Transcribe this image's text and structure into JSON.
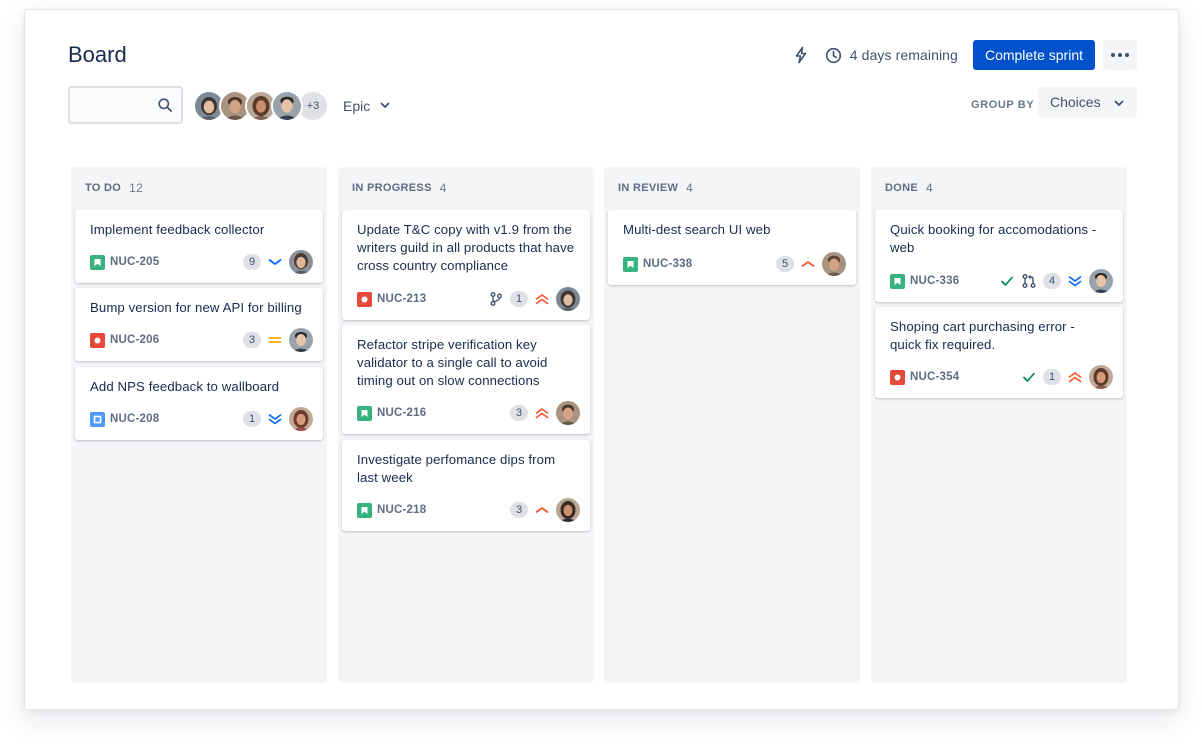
{
  "header": {
    "title": "Board",
    "remaining": "4 days remaining",
    "complete_sprint": "Complete sprint"
  },
  "toolbar": {
    "search_value": "",
    "more_people": "+3",
    "epic_label": "Epic",
    "group_by_label": "GROUP BY",
    "group_by_value": "Choices"
  },
  "colors": {
    "primary": "#0052cc",
    "story": "#36b37e",
    "bug": "#e5493a",
    "task": "#4c9aff",
    "high": "#ff5630",
    "low": "#0065ff",
    "medium": "#ffab00",
    "done_check": "#00875a"
  },
  "columns": [
    {
      "title": "TO DO",
      "count": "12",
      "cards": [
        {
          "title": "Implement feedback collector",
          "key": "NUC-205",
          "type": "story-icon",
          "badge": "9",
          "priority": "low-icon"
        },
        {
          "title": "Bump version for new API for billing",
          "key": "NUC-206",
          "type": "bug-icon",
          "badge": "3",
          "priority": "medium-icon"
        },
        {
          "title": "Add NPS feedback to wallboard",
          "key": "NUC-208",
          "type": "task-icon",
          "badge": "1",
          "priority": "lowest-icon"
        }
      ]
    },
    {
      "title": "IN PROGRESS",
      "count": "4",
      "cards": [
        {
          "title": "Update T&C copy with v1.9 from the writers guild in all products that have cross country compliance",
          "key": "NUC-213",
          "type": "bug-icon",
          "badge": "1",
          "priority": "highest-icon",
          "extra": "branch-icon"
        },
        {
          "title": "Refactor stripe verification key validator to a single call to avoid timing out on slow connections",
          "key": "NUC-216",
          "type": "story-icon",
          "badge": "3",
          "priority": "highest-icon"
        },
        {
          "title": "Investigate perfomance dips from last week",
          "key": "NUC-218",
          "type": "story-icon",
          "badge": "3",
          "priority": "high-icon"
        }
      ]
    },
    {
      "title": "IN REVIEW",
      "count": "4",
      "cards": [
        {
          "title": "Multi-dest search UI web",
          "key": "NUC-338",
          "type": "story-icon",
          "badge": "5",
          "priority": "high-icon"
        }
      ]
    },
    {
      "title": "DONE",
      "count": "4",
      "cards": [
        {
          "title": "Quick booking for accomodations - web",
          "key": "NUC-336",
          "type": "story-icon",
          "badge": "4",
          "priority": "lowest-icon",
          "extra": "check-icon",
          "extra2": "pull-request-icon"
        },
        {
          "title": "Shoping cart purchasing error - quick fix required.",
          "key": "NUC-354",
          "type": "bug-icon",
          "badge": "1",
          "priority": "highest-icon",
          "extra": "check-icon"
        }
      ]
    }
  ]
}
